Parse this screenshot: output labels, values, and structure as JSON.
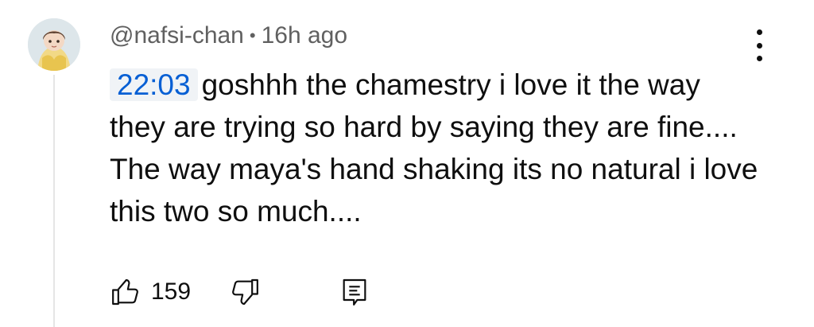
{
  "comment": {
    "author": "@nafsi-chan",
    "separator": "•",
    "time_ago": "16h ago",
    "timestamp_link": "22:03",
    "body": "goshhh the chamestry i love it the way they are trying so hard by saying they are fine.... The way maya's hand shaking its no natural i love this two so much....",
    "like_count": "159"
  },
  "icons": {
    "avatar": "avatar-image",
    "menu": "more-vertical-icon",
    "like": "thumbs-up-icon",
    "dislike": "thumbs-down-icon",
    "reply": "reply-comment-icon"
  },
  "colors": {
    "timestamp_link": "#065fd4",
    "timestamp_bg": "#f0f3f6",
    "meta_text": "#606060"
  }
}
